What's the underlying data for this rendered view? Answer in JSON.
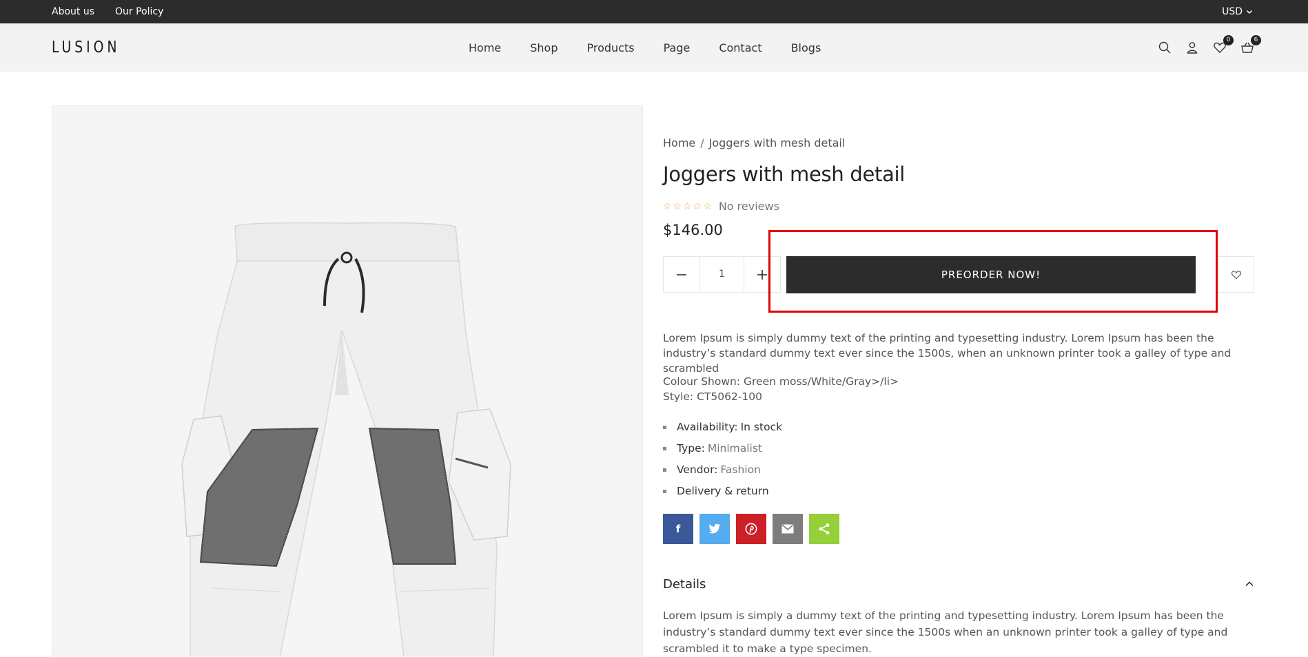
{
  "topbar": {
    "about": "About us",
    "policy": "Our Policy",
    "currency": "USD"
  },
  "header": {
    "logo": "LUSION",
    "nav": [
      "Home",
      "Shop",
      "Products",
      "Page",
      "Contact",
      "Blogs"
    ],
    "wishlist_count": "0",
    "cart_count": "6"
  },
  "product": {
    "breadcrumb_home": "Home",
    "breadcrumb_sep": "/",
    "breadcrumb_current": "Joggers with mesh detail",
    "title": "Joggers with mesh detail",
    "rating_stars": 0,
    "reviews": "No reviews",
    "price": "$146.00",
    "quantity": "1",
    "preorder_label": "PREORDER NOW!",
    "description": "Lorem Ipsum is simply dummy text of the printing and typesetting industry. Lorem Ipsum has been the industry’s standard dummy text ever since the 1500s, when an unknown printer took a galley of type and scrambled",
    "colour_shown": "Colour Shown: Green moss/White/Gray>/li>",
    "style": "Style: CT5062-100",
    "specs": [
      {
        "label": "Availability:",
        "value": "In stock"
      },
      {
        "label": "Type:",
        "value": "Minimalist"
      },
      {
        "label": "Vendor:",
        "value": "Fashion"
      },
      {
        "label": "Delivery & return",
        "value": ""
      }
    ],
    "details_title": "Details",
    "details_text": "Lorem Ipsum is simply a dummy text of the printing and typesetting industry. Lorem Ipsum has been the industry’s standard dummy text ever since the 1500s when an unknown printer took a galley of type and scrambled it to make a type specimen."
  },
  "share": [
    {
      "icon": "facebook-icon",
      "color": "#3b5998"
    },
    {
      "icon": "twitter-icon",
      "color": "#55acee"
    },
    {
      "icon": "pinterest-icon",
      "color": "#cb2027"
    },
    {
      "icon": "email-icon",
      "color": "#7d7d7d"
    },
    {
      "icon": "share-icon",
      "color": "#95d03a"
    }
  ],
  "colors": {
    "dark": "#2c2c2c",
    "highlight": "#e00000",
    "star": "#e7a54b"
  }
}
